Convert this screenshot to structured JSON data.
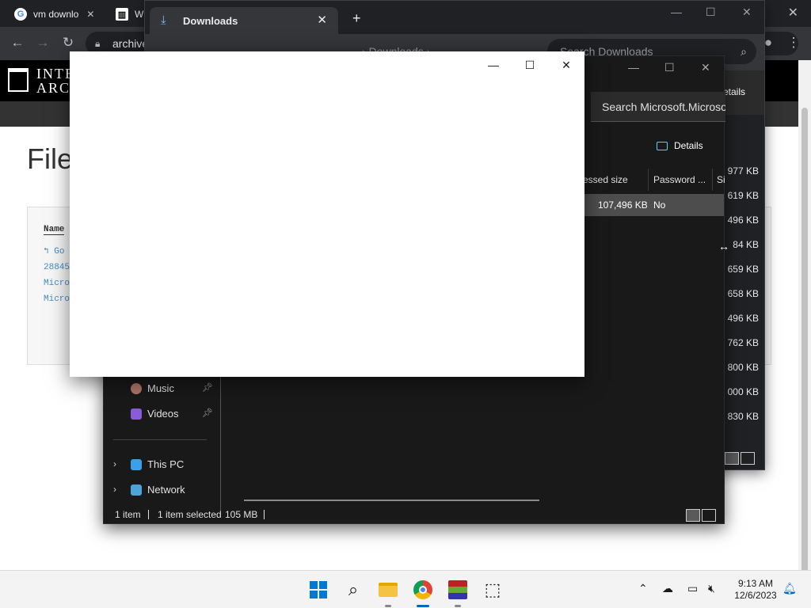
{
  "chrome": {
    "tabs": [
      {
        "label": "vm downlo",
        "favicon": "google-icon"
      },
      {
        "label": "Wi",
        "favicon": "internet-archive-icon"
      }
    ],
    "omnibox_text": "archive",
    "page": {
      "logo_line1": "INTE",
      "logo_line2": "ARCH",
      "title": "File",
      "file_list": {
        "column_header": "Name",
        "items": [
          "Go",
          "28845",
          "Micro",
          "Micro"
        ]
      }
    }
  },
  "downloads_window": {
    "tab_title": "Downloads",
    "breadcrumb": "Downloads",
    "search_placeholder": "Search Downloads",
    "details_label": "etails",
    "file_sizes": [
      "977 KB",
      "619 KB",
      "496 KB",
      "84 KB",
      "659 KB",
      "658 KB",
      "496 KB",
      "762 KB",
      "800 KB",
      "000 KB",
      "830 KB"
    ]
  },
  "explorer_window": {
    "search_placeholder": "Search Microsoft.Microso",
    "details_button": "Details",
    "columns": [
      "essed size",
      "Password ...",
      "Si"
    ],
    "row": {
      "compressed_size": "107,496 KB",
      "password": "No"
    },
    "nav": {
      "music": "Music",
      "videos": "Videos",
      "this_pc": "This PC",
      "network": "Network"
    },
    "status": {
      "items": "1 item",
      "selected": "1 item selected",
      "size": "105 MB"
    }
  },
  "taskbar": {
    "time": "9:13 AM",
    "date": "12/6/2023",
    "apps": [
      "start-icon",
      "search-icon",
      "file-explorer-icon",
      "chrome-icon",
      "winrar-icon",
      "package-icon"
    ]
  },
  "colors": {
    "accent": "#0078d4",
    "dark_bg": "#191919",
    "chrome_dark": "#202124"
  }
}
